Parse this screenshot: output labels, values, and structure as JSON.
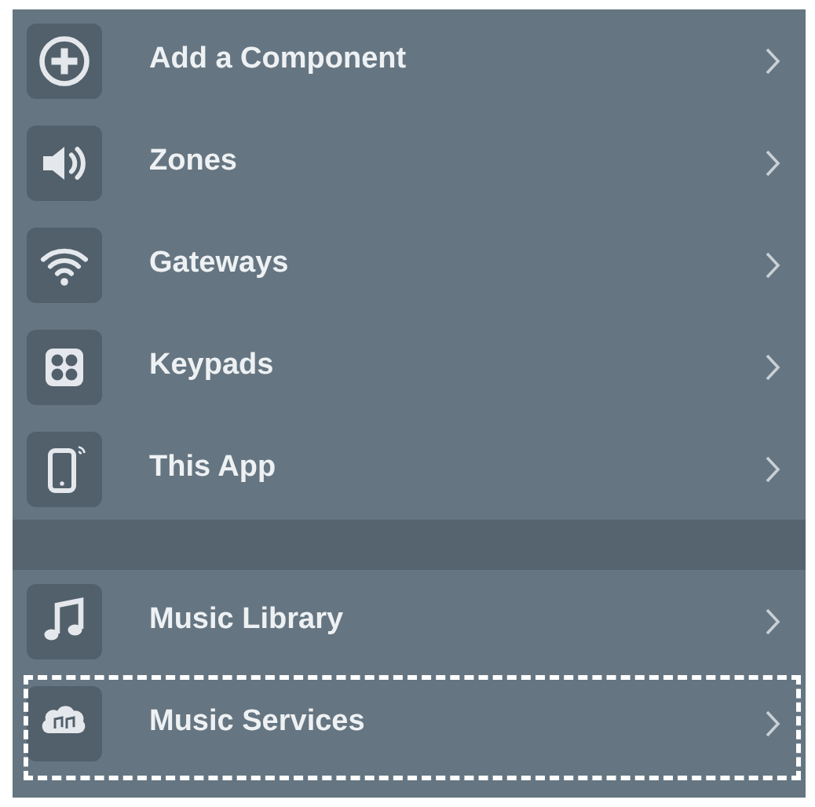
{
  "sections": [
    {
      "items": [
        {
          "label": "Add a Component",
          "highlighted": false
        },
        {
          "label": "Zones",
          "highlighted": false
        },
        {
          "label": "Gateways",
          "highlighted": false
        },
        {
          "label": "Keypads",
          "highlighted": false
        },
        {
          "label": "This App",
          "highlighted": false
        }
      ]
    },
    {
      "items": [
        {
          "label": "Music Library",
          "highlighted": false
        },
        {
          "label": "Music Services",
          "highlighted": true
        }
      ]
    }
  ]
}
